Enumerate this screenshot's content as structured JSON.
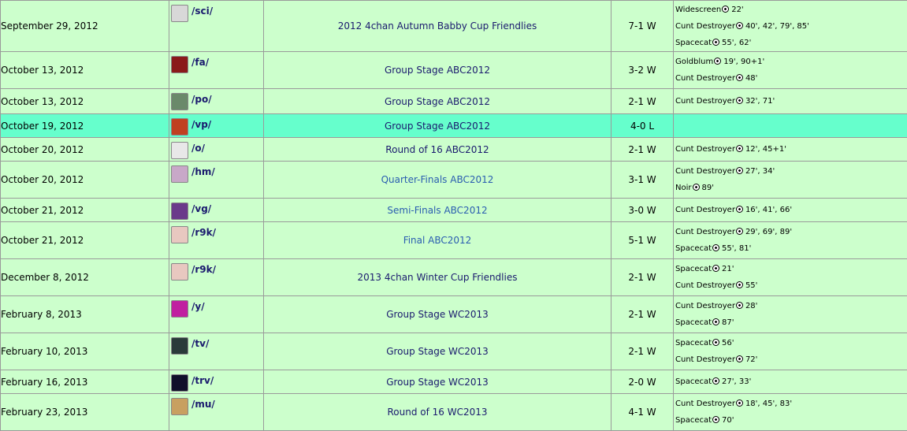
{
  "matches": [
    {
      "date": "September 29, 2012",
      "team": "/sci/",
      "icon": "sci-board-icon",
      "icon_color": "#d8d8d8",
      "competition": "2012 4chan Autumn Babby Cup Friendlies",
      "score": "7-1 W",
      "scorers": [
        {
          "name": "Widescreen",
          "minutes": "22'"
        },
        {
          "name": "Cunt Destroyer",
          "minutes": "40', 42', 79', 85'"
        },
        {
          "name": "Spacecat",
          "minutes": "55', 62'"
        }
      ]
    },
    {
      "date": "October 13, 2012",
      "team": "/fa/",
      "icon": "fa-board-icon",
      "icon_color": "#8a1a1a",
      "competition": "Group Stage ABC2012",
      "score": "3-2 W",
      "scorers": [
        {
          "name": "Goldblum",
          "minutes": "19', 90+1'"
        },
        {
          "name": "Cunt Destroyer",
          "minutes": "48'"
        }
      ]
    },
    {
      "date": "October 13, 2012",
      "team": "/po/",
      "icon": "po-board-icon",
      "icon_color": "#6a8a6a",
      "competition": "Group Stage ABC2012",
      "score": "2-1 W",
      "scorers": [
        {
          "name": "Cunt Destroyer",
          "minutes": "32', 71'"
        }
      ]
    },
    {
      "date": "October 19, 2012",
      "team": "/vp/",
      "icon": "vp-board-icon",
      "icon_color": "#c04020",
      "competition": "Group Stage ABC2012",
      "score": "4-0 L",
      "scorers": [],
      "highlight": true
    },
    {
      "date": "October 20, 2012",
      "team": "/o/",
      "icon": "o-board-icon",
      "icon_color": "#e8e8e8",
      "competition": "Round of 16 ABC2012",
      "score": "2-1 W",
      "scorers": [
        {
          "name": "Cunt Destroyer",
          "minutes": "12', 45+1'"
        }
      ]
    },
    {
      "date": "October 20, 2012",
      "team": "/hm/",
      "icon": "hm-board-icon",
      "icon_color": "#c8a8c8",
      "competition": "Quarter-Finals ABC2012",
      "score": "3-1 W",
      "scorers": [
        {
          "name": "Cunt Destroyer",
          "minutes": "27', 34'"
        },
        {
          "name": "Noir",
          "minutes": "89'"
        }
      ]
    },
    {
      "date": "October 21, 2012",
      "team": "/vg/",
      "icon": "vg-board-icon",
      "icon_color": "#6a3a8a",
      "competition": "Semi-Finals ABC2012",
      "score": "3-0 W",
      "scorers": [
        {
          "name": "Cunt Destroyer",
          "minutes": "16', 41', 66'"
        }
      ]
    },
    {
      "date": "October 21, 2012",
      "team": "/r9k/",
      "icon": "r9k-board-icon",
      "icon_color": "#e8c8c0",
      "competition": "Final ABC2012",
      "score": "5-1 W",
      "scorers": [
        {
          "name": "Cunt Destroyer",
          "minutes": "29', 69', 89'"
        },
        {
          "name": "Spacecat",
          "minutes": "55', 81'"
        }
      ]
    },
    {
      "date": "December 8, 2012",
      "team": "/r9k/",
      "icon": "r9k-board-icon",
      "icon_color": "#e8c8c0",
      "competition": "2013 4chan Winter Cup Friendlies",
      "score": "2-1 W",
      "scorers": [
        {
          "name": "Spacecat",
          "minutes": "21'"
        },
        {
          "name": "Cunt Destroyer",
          "minutes": "55'"
        }
      ]
    },
    {
      "date": "February 8, 2013",
      "team": "/y/",
      "icon": "y-board-icon",
      "icon_color": "#c020a0",
      "competition": "Group Stage WC2013",
      "score": "2-1 W",
      "scorers": [
        {
          "name": "Cunt Destroyer",
          "minutes": "28'"
        },
        {
          "name": "Spacecat",
          "minutes": "87'"
        }
      ]
    },
    {
      "date": "February 10, 2013",
      "team": "/tv/",
      "icon": "tv-board-icon",
      "icon_color": "#2a3a3a",
      "competition": "Group Stage WC2013",
      "score": "2-1 W",
      "scorers": [
        {
          "name": "Spacecat",
          "minutes": "56'"
        },
        {
          "name": "Cunt Destroyer",
          "minutes": "72'"
        }
      ]
    },
    {
      "date": "February 16, 2013",
      "team": "/trv/",
      "icon": "trv-board-icon",
      "icon_color": "#10102a",
      "competition": "Group Stage WC2013",
      "score": "2-0 W",
      "scorers": [
        {
          "name": "Spacecat",
          "minutes": "27', 33'"
        }
      ]
    },
    {
      "date": "February 23, 2013",
      "team": "/mu/",
      "icon": "mu-board-icon",
      "icon_color": "#c8a060",
      "competition": "Round of 16 WC2013",
      "score": "4-1 W",
      "scorers": [
        {
          "name": "Cunt Destroyer",
          "minutes": "18', 45', 83'"
        },
        {
          "name": "Spacecat",
          "minutes": "70'"
        }
      ]
    }
  ]
}
